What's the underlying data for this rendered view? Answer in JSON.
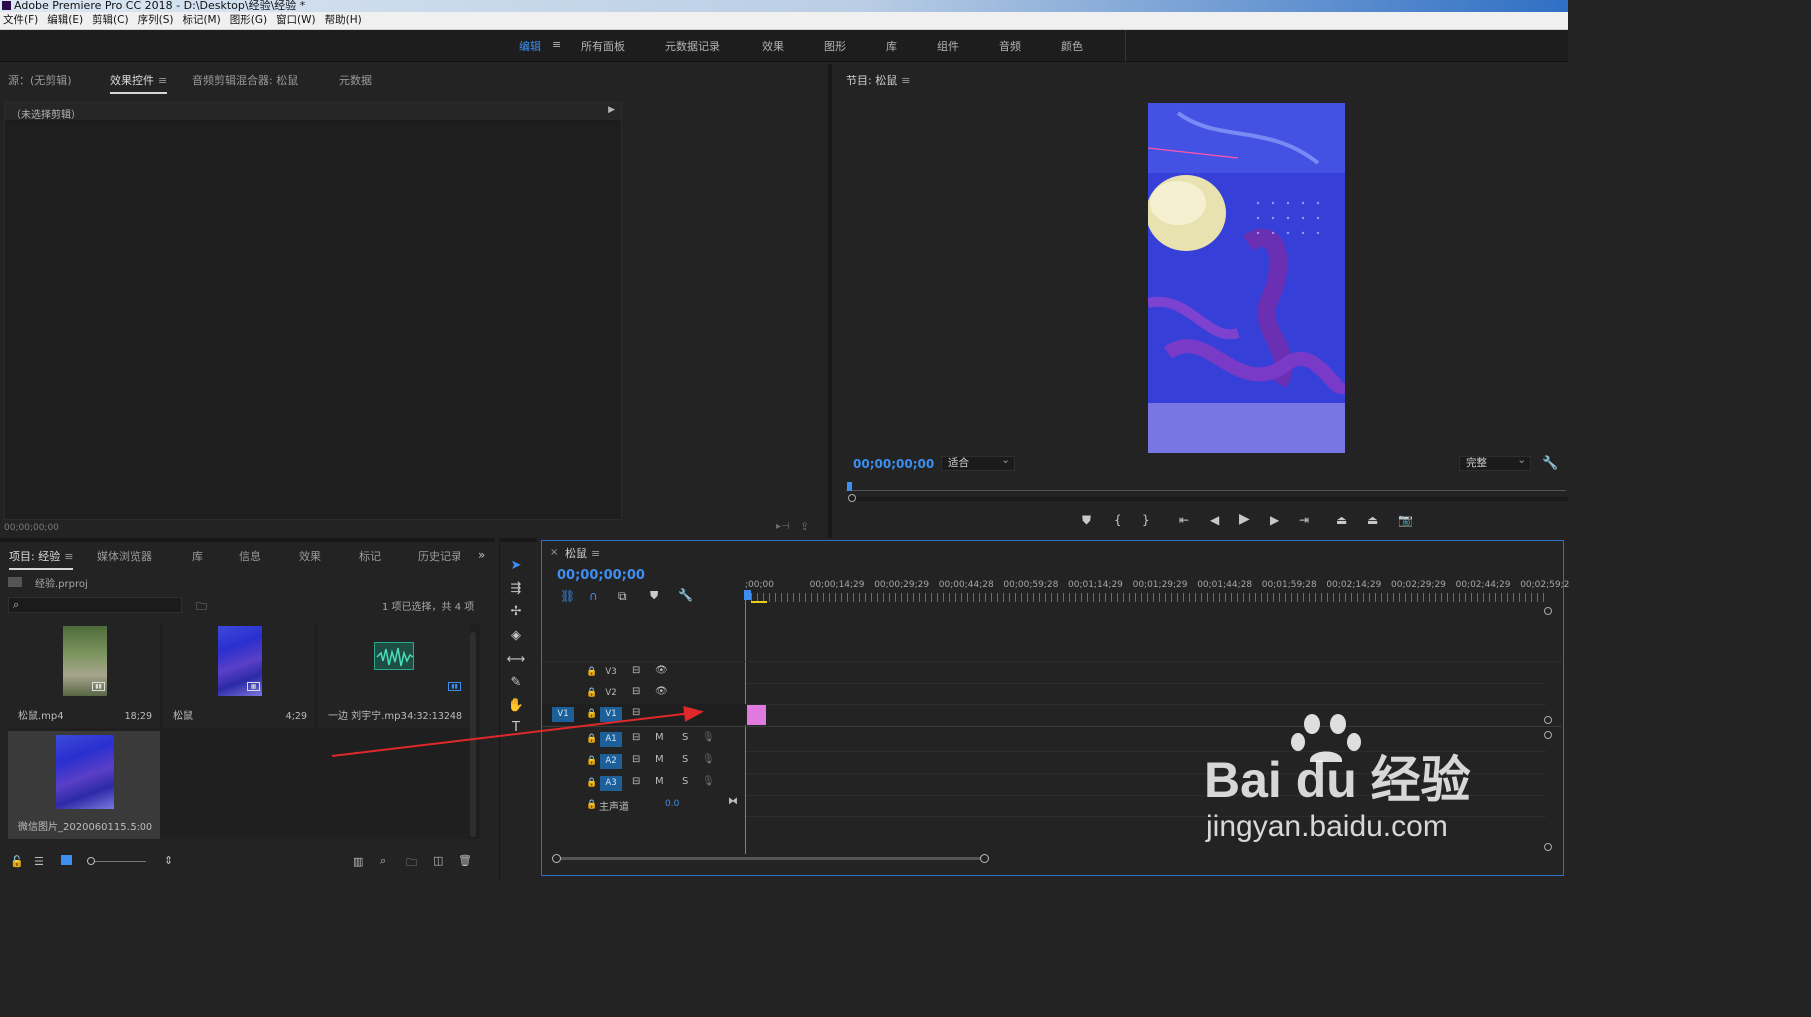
{
  "window": {
    "title": "Adobe Premiere Pro CC 2018 - D:\\Desktop\\经验\\经验 *"
  },
  "menu": [
    "文件(F)",
    "编辑(E)",
    "剪辑(C)",
    "序列(S)",
    "标记(M)",
    "图形(G)",
    "窗口(W)",
    "帮助(H)"
  ],
  "workspaces": {
    "active": "编辑",
    "items": [
      "所有面板",
      "元数据记录",
      "效果",
      "图形",
      "库",
      "组件",
      "音频",
      "颜色"
    ]
  },
  "source_panel": {
    "tabs": [
      "源：(无剪辑)",
      "效果控件",
      "音频剪辑混合器: 松鼠",
      "元数据"
    ],
    "selected_tab": "效果控件",
    "clip_label": "（未选择剪辑）",
    "timecode": "00;00;00;00"
  },
  "program_monitor": {
    "title": "节目: 松鼠",
    "timecode": "00;00;00;00",
    "fit": "适合",
    "quality": "完整"
  },
  "project_panel": {
    "tabs": [
      "项目: 经验",
      "媒体浏览器",
      "库",
      "信息",
      "效果",
      "标记",
      "历史记录"
    ],
    "file": "经验.prproj",
    "search_placeholder": "",
    "selection_status": "1 项已选择，共 4 项",
    "items": [
      {
        "name": "松鼠.mp4",
        "duration": "18;29"
      },
      {
        "name": "松鼠",
        "duration": "4;29"
      },
      {
        "name": "一边 刘宇宁.mp3",
        "duration": "4:32:13248"
      },
      {
        "name": "微信图片_2020060115...",
        "duration": "5:00"
      }
    ]
  },
  "timeline": {
    "sequence_name": "松鼠",
    "timecode": "00;00;00;00",
    "ruler": [
      ";00;00",
      "00;00;14;29",
      "00;00;29;29",
      "00;00;44;28",
      "00;00;59;28",
      "00;01;14;29",
      "00;01;29;29",
      "00;01;44;28",
      "00;01;59;28",
      "00;02;14;29",
      "00;02;29;29",
      "00;02;44;29",
      "00;02;59;2"
    ],
    "video_tracks": [
      {
        "name": "V3"
      },
      {
        "name": "V2"
      },
      {
        "name": "V1",
        "source": "V1"
      }
    ],
    "audio_tracks": [
      {
        "name": "A1"
      },
      {
        "name": "A2"
      },
      {
        "name": "A3"
      }
    ],
    "mute_label": "M",
    "solo_label": "S",
    "master": {
      "label": "主声道",
      "value": "0.0"
    },
    "clip_color": "#e07ae0"
  },
  "watermark": {
    "brand": "Bai du 经验",
    "url": "jingyan.baidu.com"
  },
  "colors": {
    "accent": "#3d8ef0",
    "annotation_arrow": "#e0282a",
    "track_highlight": "#1d5f99"
  }
}
